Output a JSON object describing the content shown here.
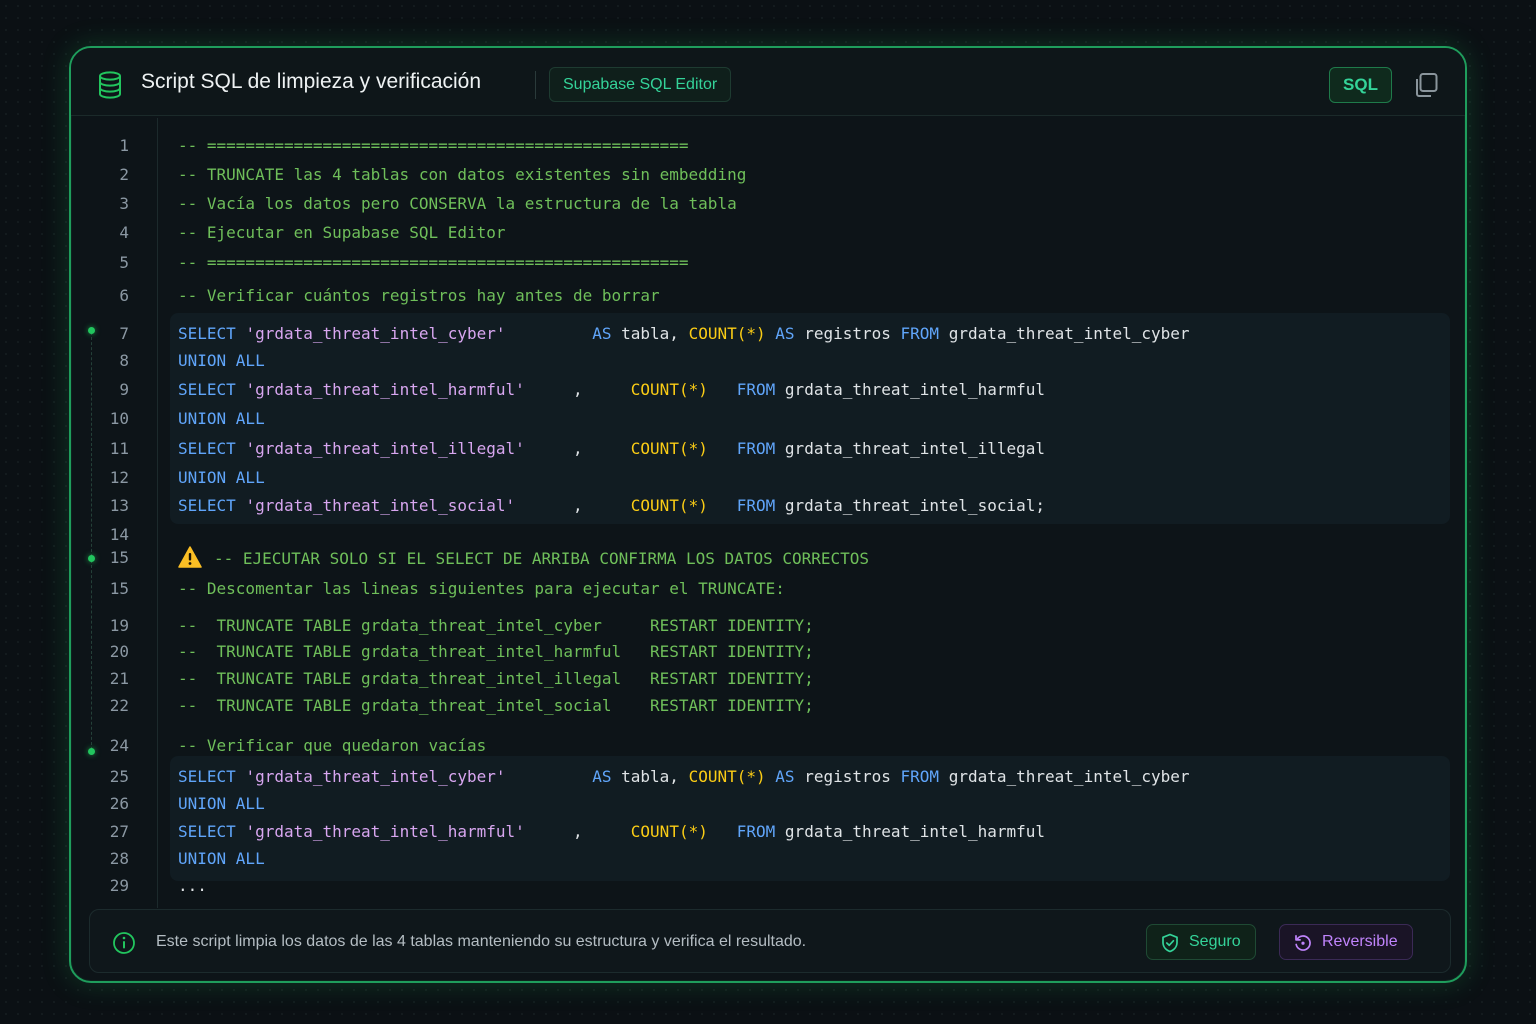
{
  "header": {
    "title": "Script SQL de limpieza y verificación",
    "editor_chip": "Supabase SQL Editor",
    "language_badge": "SQL"
  },
  "code": {
    "l1_num": "1",
    "l1_text": "-- ==================================================",
    "l2_num": "2",
    "l2_text": "-- TRUNCATE las 4 tablas con datos existentes sin embedding",
    "l3_num": "3",
    "l3_text": "-- Vacía los datos pero CONSERVA la estructura de la tabla",
    "l4_num": "4",
    "l4_text": "-- Ejecutar en Supabase SQL Editor",
    "l5_num": "5",
    "l5_text": "-- ==================================================",
    "l6_num": "6",
    "l6_text": "-- Verificar cuántos registros hay antes de borrar",
    "l7_num": "7",
    "l7": {
      "k1": "SELECT",
      "s": "'grdata_threat_intel_cyber'",
      "k2": "AS",
      "p1": "tabla,",
      "f": "COUNT(*)",
      "k3": "AS",
      "p2": "registros",
      "k4": "FROM",
      "p3": "grdata_threat_intel_cyber"
    },
    "l8_num": "8",
    "l8_text": "UNION ALL",
    "l9_num": "9",
    "l9": {
      "k1": "SELECT",
      "s": "'grdata_threat_intel_harmful'",
      "p1": ",",
      "f": "COUNT(*)",
      "k2": "FROM",
      "p2": "grdata_threat_intel_harmful"
    },
    "l10_num": "10",
    "l10_text": "UNION ALL",
    "l11_num": "11",
    "l11": {
      "k1": "SELECT",
      "s": "'grdata_threat_intel_illegal'",
      "p1": ",",
      "f": "COUNT(*)",
      "k2": "FROM",
      "p2": "grdata_threat_intel_illegal"
    },
    "l12_num": "12",
    "l12_text": "UNION ALL",
    "l13_num": "13",
    "l13": {
      "k1": "SELECT",
      "s": "'grdata_threat_intel_social'",
      "p1": ",",
      "f": "COUNT(*)",
      "k2": "FROM",
      "p2": "grdata_threat_intel_social;"
    },
    "l14_num": "14",
    "l15_num": "15",
    "l15_text": "-- EJECUTAR SOLO SI EL SELECT DE ARRIBA CONFIRMA LOS DATOS CORRECTOS",
    "l16_num": "15",
    "l16_text": "-- Descomentar las lineas siguientes para ejecutar el TRUNCATE:",
    "l19_num": "19",
    "l19_text": "--  TRUNCATE TABLE grdata_threat_intel_cyber     RESTART IDENTITY;",
    "l20_num": "20",
    "l20_text": "--  TRUNCATE TABLE grdata_threat_intel_harmful   RESTART IDENTITY;",
    "l21_num": "21",
    "l21_text": "--  TRUNCATE TABLE grdata_threat_intel_illegal   RESTART IDENTITY;",
    "l22_num": "22",
    "l22_text": "--  TRUNCATE TABLE grdata_threat_intel_social    RESTART IDENTITY;",
    "l24_num": "24",
    "l24_text": "-- Verificar que quedaron vacías",
    "l25_num": "25",
    "l25": {
      "k1": "SELECT",
      "s": "'grdata_threat_intel_cyber'",
      "k2": "AS",
      "p1": "tabla,",
      "f": "COUNT(*)",
      "k3": "AS",
      "p2": "registros",
      "k4": "FROM",
      "p3": "grdata_threat_intel_cyber"
    },
    "l26_num": "26",
    "l26_text": "UNION ALL",
    "l27_num": "27",
    "l27": {
      "k1": "SELECT",
      "s": "'grdata_threat_intel_harmful'",
      "p1": ",",
      "f": "COUNT(*)",
      "k2": "FROM",
      "p2": "grdata_threat_intel_harmful"
    },
    "l28_num": "28",
    "l28_text": "UNION ALL",
    "l29_num": "29",
    "l29_text": "..."
  },
  "footer": {
    "text": "Este script limpia los datos de las 4 tablas manteniendo su estructura y verifica el resultado.",
    "tag_safe": "Seguro",
    "tag_reversible": "Reversible"
  },
  "icons": {
    "header": "database-icon",
    "copy": "copy-icon",
    "warning": "warning-icon",
    "info": "info-icon",
    "safe": "shield-check-icon",
    "reversible": "rotate-ccw-icon"
  },
  "colors": {
    "accent": "#22c55e",
    "comment": "#6fbf5a",
    "keyword": "#60a5fa",
    "string": "#d8a6f0",
    "function": "#facc15",
    "warning": "#fbbf24",
    "reversible": "#c084fc"
  }
}
